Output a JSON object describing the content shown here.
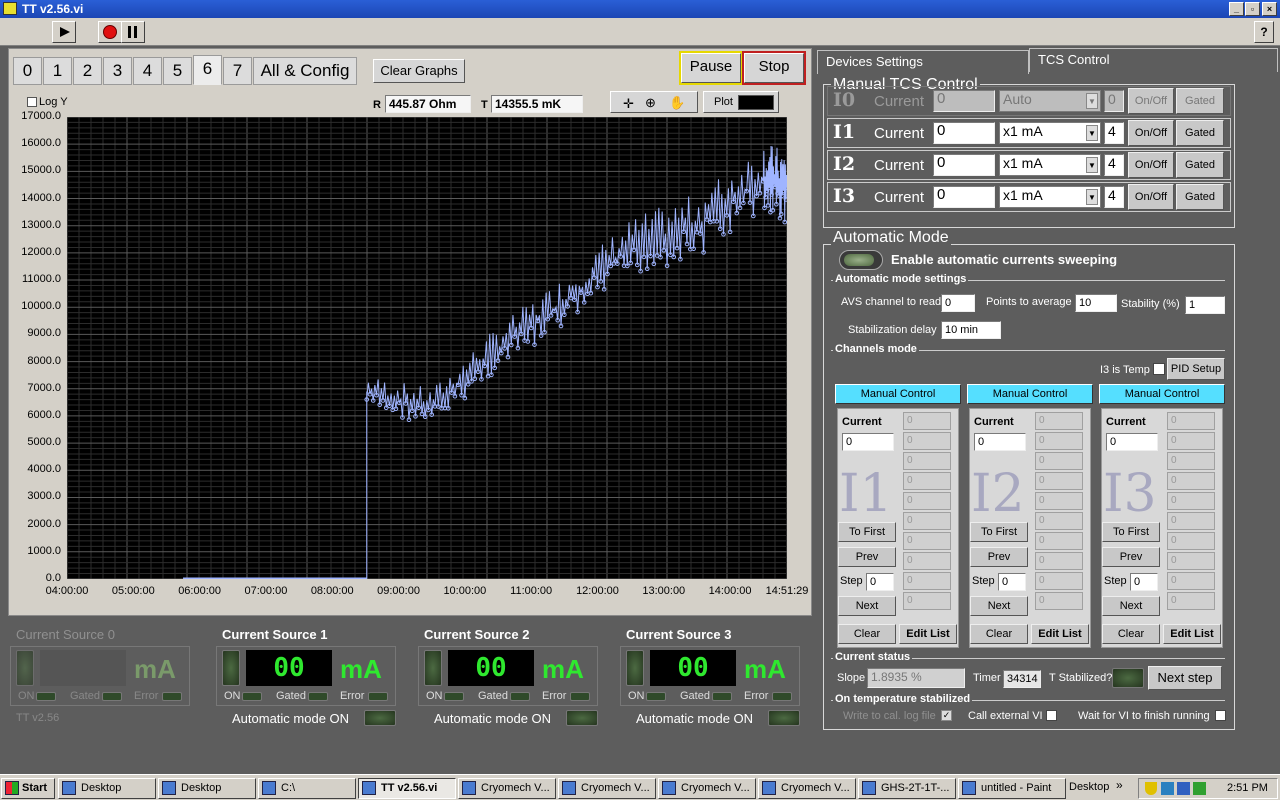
{
  "window": {
    "title": "TT v2.56.vi",
    "minimize": "_",
    "maximize": "▫",
    "close": "×",
    "help": "?"
  },
  "tabs": [
    "0",
    "1",
    "2",
    "3",
    "4",
    "5",
    "6",
    "7",
    "All & Config"
  ],
  "active_tab": "6",
  "buttons": {
    "clear_graphs": "Clear Graphs",
    "pause": "Pause",
    "stop": "Stop",
    "plot": "Plot"
  },
  "logy": "Log Y",
  "readouts": {
    "r_label": "R",
    "r_value": "445.87 Ohm",
    "t_label": "T",
    "t_value": "14355.5 mK"
  },
  "chart_data": {
    "type": "line",
    "yticks": [
      "17000.0",
      "16000.0",
      "15000.0",
      "14000.0",
      "13000.0",
      "12000.0",
      "11000.0",
      "10000.0",
      "9000.0",
      "8000.0",
      "7000.0",
      "6000.0",
      "5000.0",
      "4000.0",
      "3000.0",
      "2000.0",
      "1000.0",
      "0.0"
    ],
    "xticks": [
      "04:00:00",
      "05:00:00",
      "06:00:00",
      "07:00:00",
      "08:00:00",
      "09:00:00",
      "10:00:00",
      "11:00:00",
      "12:00:00",
      "13:00:00",
      "14:00:00",
      "14:51:29"
    ],
    "ylim": [
      0,
      17000
    ],
    "xlim_hours": [
      4.0,
      14.858
    ],
    "series_color": "#9fb4ff",
    "segments": [
      {
        "x": [
          5.75,
          8.52
        ],
        "y": [
          0,
          0
        ]
      },
      {
        "x": [
          8.52,
          8.52
        ],
        "y": [
          0,
          6900
        ]
      },
      {
        "x": [
          8.52,
          9.5,
          10.5,
          11.5,
          12.5,
          13.5,
          14.5,
          14.86
        ],
        "y": [
          6900,
          6300,
          8500,
          10200,
          12200,
          13000,
          14800,
          14400
        ]
      }
    ]
  },
  "sources": [
    {
      "title": "Current Source 0",
      "value": "",
      "unit": "mA",
      "on": "ON",
      "gated": "Gated",
      "error": "Error",
      "footer": "TT v2.56",
      "active": false
    },
    {
      "title": "Current Source 1",
      "value": "00",
      "unit": "mA",
      "on": "ON",
      "gated": "Gated",
      "error": "Error",
      "footer": "Automatic mode ON",
      "active": true
    },
    {
      "title": "Current Source 2",
      "value": "00",
      "unit": "mA",
      "on": "ON",
      "gated": "Gated",
      "error": "Error",
      "footer": "Automatic mode ON",
      "active": true
    },
    {
      "title": "Current Source 3",
      "value": "00",
      "unit": "mA",
      "on": "ON",
      "gated": "Gated",
      "error": "Error",
      "footer": "Automatic mode ON",
      "active": true
    }
  ],
  "right_tabs": [
    "Devices Settings",
    "TCS Control"
  ],
  "manual": {
    "title": "Manual TCS Control",
    "rows": [
      {
        "name": "I0",
        "label": "Current",
        "value": "0",
        "range": "Auto",
        "n": "0",
        "onoff": "On/Off",
        "gated": "Gated",
        "dim": true
      },
      {
        "name": "I1",
        "label": "Current",
        "value": "0",
        "range": "x1 mA",
        "n": "4",
        "onoff": "On/Off",
        "gated": "Gated",
        "dim": false
      },
      {
        "name": "I2",
        "label": "Current",
        "value": "0",
        "range": "x1 mA",
        "n": "4",
        "onoff": "On/Off",
        "gated": "Gated",
        "dim": false
      },
      {
        "name": "I3",
        "label": "Current",
        "value": "0",
        "range": "x1 mA",
        "n": "4",
        "onoff": "On/Off",
        "gated": "Gated",
        "dim": false
      }
    ]
  },
  "auto": {
    "title": "Automatic Mode",
    "enable": "Enable automatic currents sweeping",
    "settings_title": "Automatic mode settings",
    "avs_label": "AVS channel to read",
    "avs_value": "0",
    "points_label": "Points to average",
    "points_value": "10",
    "stability_label": "Stability (%)",
    "stability_value": "1",
    "delay_label": "Stabilization delay",
    "delay_value": "10 min",
    "channels_title": "Channels mode",
    "i3_temp": "I3 is Temp",
    "pid_setup": "PID Setup",
    "channels": [
      {
        "mode": "Manual Control",
        "big": "I1",
        "current_label": "Current",
        "current": "0",
        "to_first": "To First",
        "prev": "Prev",
        "step_label": "Step",
        "step": "0",
        "next": "Next",
        "clear": "Clear",
        "edit": "Edit List",
        "list": [
          "0",
          "0",
          "0",
          "0",
          "0",
          "0",
          "0",
          "0",
          "0",
          "0"
        ]
      },
      {
        "mode": "Manual Control",
        "big": "I2",
        "current_label": "Current",
        "current": "0",
        "to_first": "To First",
        "prev": "Prev",
        "step_label": "Step",
        "step": "0",
        "next": "Next",
        "clear": "Clear",
        "edit": "Edit List",
        "list": [
          "0",
          "0",
          "0",
          "0",
          "0",
          "0",
          "0",
          "0",
          "0",
          "0"
        ]
      },
      {
        "mode": "Manual Control",
        "big": "I3",
        "current_label": "Current",
        "current": "0",
        "to_first": "To First",
        "prev": "Prev",
        "step_label": "Step",
        "step": "0",
        "next": "Next",
        "clear": "Clear",
        "edit": "Edit List",
        "list": [
          "0",
          "0",
          "0",
          "0",
          "0",
          "0",
          "0",
          "0",
          "0",
          "0"
        ]
      }
    ],
    "status_title": "Current status",
    "slope_label": "Slope",
    "slope_value": "1.8935 %",
    "timer_label": "Timer",
    "timer_value": "34314",
    "stabilized_label": "T Stabilized?",
    "next_step": "Next step",
    "on_temp_title": "On temperature stabilized",
    "write_log": "Write to cal. log file",
    "call_vi": "Call external VI",
    "wait_vi": "Wait for VI to finish running"
  },
  "taskbar": {
    "start": "Start",
    "items": [
      "Desktop",
      "Desktop",
      "C:\\",
      "TT v2.56.vi",
      "Cryomech V...",
      "Cryomech V...",
      "Cryomech V...",
      "Cryomech V...",
      "GHS-2T-1T-...",
      "untitled - Paint"
    ],
    "desktop": "Desktop",
    "clock": "2:51 PM"
  }
}
